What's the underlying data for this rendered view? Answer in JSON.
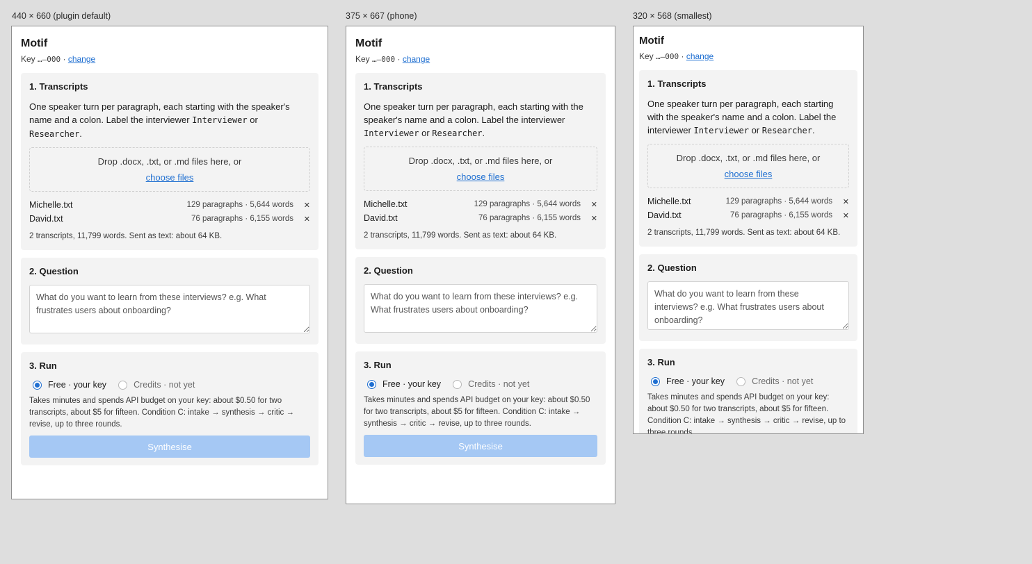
{
  "frames": [
    {
      "label": "440 × 660 (plugin default)"
    },
    {
      "label": "375 × 667 (phone)"
    },
    {
      "label": "320 × 568 (smallest)"
    }
  ],
  "app": {
    "title": "Motif",
    "key_prefix": "Key ",
    "key_value": "…–000",
    "key_sep": " · ",
    "key_change": "change"
  },
  "transcripts": {
    "title": "1. Transcripts",
    "instr_1": "One speaker turn per paragraph, each starting with the speaker's name and a colon. Label the interviewer ",
    "code_1": "Interviewer",
    "instr_or": " or ",
    "code_2": "Researcher",
    "instr_end": ".",
    "drop_text": "Drop .docx, .txt, or .md files here, or",
    "choose": "choose files",
    "files": [
      {
        "name": "Michelle.txt",
        "meta": "129 paragraphs · 5,644 words",
        "remove": "✕"
      },
      {
        "name": "David.txt",
        "meta": "76 paragraphs · 6,155 words",
        "remove": "✕"
      }
    ],
    "summary": "2 transcripts, 11,799 words. Sent as text: about 64 KB."
  },
  "question": {
    "title": "2. Question",
    "placeholder": "What do you want to learn from these interviews? e.g. What frustrates users about onboarding?"
  },
  "run": {
    "title": "3. Run",
    "opt_free": "Free · your key",
    "opt_credits": "Credits · not yet",
    "desc": "Takes minutes and spends API budget on your key: about $0.50 for two transcripts, about $5 for fifteen. Condition C: intake → synthesis → critic → revise, up to three rounds.",
    "button": "Synthesise"
  },
  "colors": {
    "accent": "#1f6fd1",
    "button_disabled": "#a5c8f4",
    "panel": "#f3f3f3",
    "canvas": "#dedede"
  }
}
